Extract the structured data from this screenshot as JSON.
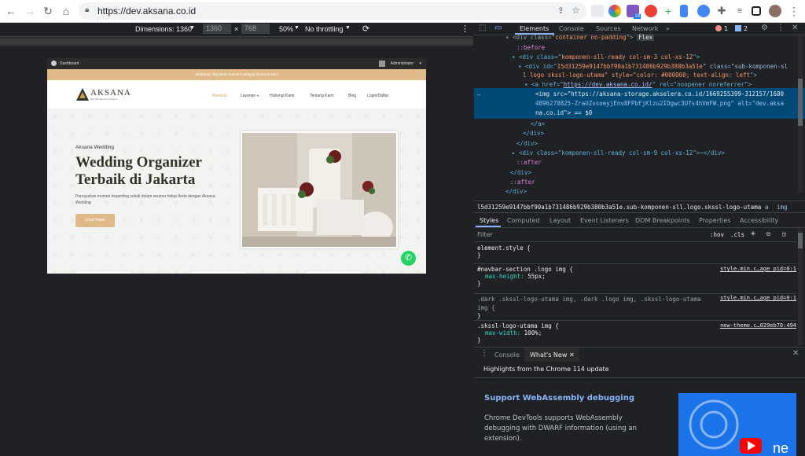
{
  "browser": {
    "url": "https://dev.aksana.co.id",
    "extension_badge": "18"
  },
  "device_toolbar": {
    "dimensions_label": "Dimensions: 1360",
    "width": "1360",
    "times": "×",
    "height": "768",
    "zoom": "50%",
    "throttling": "No throttling"
  },
  "site": {
    "admin_left": "Dashboard",
    "admin_user": "Administrator",
    "promo": "Wedding | Wujudkan moment bahagia bersama kami",
    "logo_text": "AKSANA",
    "logo_sub": "WO Management System",
    "nav": [
      "Beranda",
      "Layanan",
      "Hubungi Kami",
      "Tentang Kami",
      "Blog",
      "Login/Daftar"
    ],
    "hero_kicker": "Aksana Wedding",
    "hero_title_1": "Wedding Organizer",
    "hero_title_2": "Terbaik di Jakarta",
    "hero_desc": "Percayakan momen terpenting sekali dalam seumur hidup Anda dengan Aksana Wedding",
    "hero_button": "Lihat Paket",
    "accent_color": "#e0b98a",
    "title_color": "#2f3426"
  },
  "devtools": {
    "tabs": [
      "Elements",
      "Console",
      "Sources",
      "Network",
      "»"
    ],
    "error_count": "1",
    "msg_count": "2",
    "dom_lines": [
      {
        "pre": "▾ <div class=\"",
        "attr": "container no-padding",
        "post": "\"> ",
        "badge": "Flex"
      },
      {
        "pre": "::before",
        "attr": "",
        "post": ""
      },
      {
        "pre": "▾ <div class=\"",
        "attr": "komponen-sll-ready col-sm-3 col-xs-12",
        "post": "\">"
      },
      {
        "pre": "▾ <div id=\"",
        "attr": "15d31259e9147bbf90a1b731486b929b380b3a51e",
        "post": "\" class=\"sub-komponen-sl"
      },
      {
        "pre": "l logo skssl-logo-utama\" style=\"",
        "attr": "color: #000000; text-align: left",
        "post": "\">"
      },
      {
        "pre": "▾ <a href=\"",
        "attr": "https://dev.aksana.co.id/",
        "post": "\" rel=\"noopener noreferrer\">"
      }
    ],
    "img_line_1": "<img src=\"https://aksana-storage.akselera.co.id/1669255399-312157/1680",
    "img_line_2": "4896278825-ZraUZvsoeyjEnv8FPbFjKlzu2IDgwc3Ufs4hVmFW.png\" alt=\"dev.aksa",
    "img_line_3": "na.co.id\"> == $0",
    "dom_after": [
      "</a>",
      "</div>",
      "</div>",
      "▸ <div class=\"komponen-sll-ready col-sm-9 col-xs-12\">⋯</div>",
      "::after",
      "</div>",
      "::after",
      "</div>"
    ],
    "breadcrumb": "l5d31259e9147bbf90a1b731486b929b380b3a51e.sub-komponen-sll.logo.skssl-logo-utama",
    "breadcrumb_a": "a",
    "breadcrumb_img": "img",
    "style_tabs": [
      "Styles",
      "Computed",
      "Layout",
      "Event Listeners",
      "DOM Breakpoints",
      "Properties",
      "Accessibility"
    ],
    "filter_placeholder": "Filter",
    "hov": ":hov",
    "cls": ".cls",
    "rules": [
      {
        "selector": "element.style {",
        "source": "",
        "props": [],
        "close": "}"
      },
      {
        "selector": "#navbar-section .logo img {",
        "source": "style.min.c…age_pid=0:1",
        "props": [
          [
            "max-height",
            "55px;"
          ]
        ],
        "close": "}"
      },
      {
        "selector": ".dark .skssl-logo-utama img, .dark .logo img, .skssl-logo-utama img {",
        "source": "style.min.c…age_pid=0:1",
        "props": [],
        "close": "}"
      },
      {
        "selector": ".skssl-logo-utama img {",
        "source": "new-theme.c…029eb70:494",
        "props": [
          [
            "max-width",
            "100%;"
          ]
        ],
        "close": "}"
      }
    ],
    "drawer_tabs": [
      "Console",
      "What's New"
    ],
    "whatsnew_highlights": "Highlights from the Chrome 114 update",
    "whatsnew_title": "Support WebAssembly debugging",
    "whatsnew_body": "Chrome DevTools supports WebAssembly debugging with DWARF information (using an extension)."
  }
}
